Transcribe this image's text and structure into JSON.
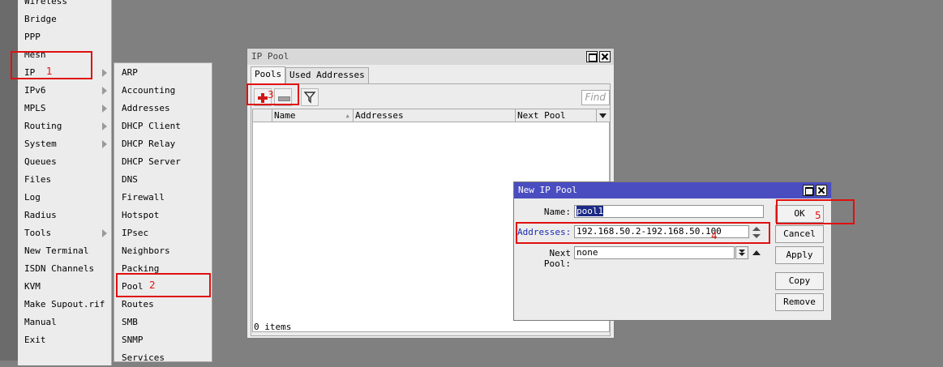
{
  "main_menu": {
    "items": [
      {
        "label": "Wireless",
        "submenu": false
      },
      {
        "label": "Bridge",
        "submenu": false
      },
      {
        "label": "PPP",
        "submenu": false
      },
      {
        "label": "Mesh",
        "submenu": false
      },
      {
        "label": "IP",
        "submenu": true
      },
      {
        "label": "IPv6",
        "submenu": true
      },
      {
        "label": "MPLS",
        "submenu": true
      },
      {
        "label": "Routing",
        "submenu": true
      },
      {
        "label": "System",
        "submenu": true
      },
      {
        "label": "Queues",
        "submenu": false
      },
      {
        "label": "Files",
        "submenu": false
      },
      {
        "label": "Log",
        "submenu": false
      },
      {
        "label": "Radius",
        "submenu": false
      },
      {
        "label": "Tools",
        "submenu": true
      },
      {
        "label": "New Terminal",
        "submenu": false
      },
      {
        "label": "ISDN Channels",
        "submenu": false
      },
      {
        "label": "KVM",
        "submenu": false
      },
      {
        "label": "Make Supout.rif",
        "submenu": false
      },
      {
        "label": "Manual",
        "submenu": false
      },
      {
        "label": "Exit",
        "submenu": false
      }
    ]
  },
  "ip_submenu": {
    "items": [
      "ARP",
      "Accounting",
      "Addresses",
      "DHCP Client",
      "DHCP Relay",
      "DHCP Server",
      "DNS",
      "Firewall",
      "Hotspot",
      "IPsec",
      "Neighbors",
      "Packing",
      "Pool",
      "Routes",
      "SMB",
      "SNMP",
      "Services"
    ]
  },
  "annotations": [
    "1",
    "2",
    "3",
    "4",
    "5"
  ],
  "ip_pool_window": {
    "title": "IP Pool",
    "tabs": [
      "Pools",
      "Used Addresses"
    ],
    "find_placeholder": "Find",
    "columns": [
      "Name",
      "Addresses",
      "Next Pool"
    ],
    "status": "0 items",
    "toolbar_icons": [
      "add-icon",
      "remove-icon",
      "filter-icon"
    ]
  },
  "new_pool_dialog": {
    "title": "New IP Pool",
    "name_label": "Name:",
    "name_value": "pool1",
    "addresses_label": "Addresses:",
    "addresses_value": "192.168.50.2-192.168.50.100",
    "next_pool_label": "Next Pool:",
    "next_pool_value": "none",
    "buttons": {
      "ok": "OK",
      "cancel": "Cancel",
      "apply": "Apply",
      "copy": "Copy",
      "remove": "Remove"
    }
  },
  "colors": {
    "highlight": "#e01010",
    "active_titlebar": "#4a4dc0",
    "desktop": "#808080"
  }
}
